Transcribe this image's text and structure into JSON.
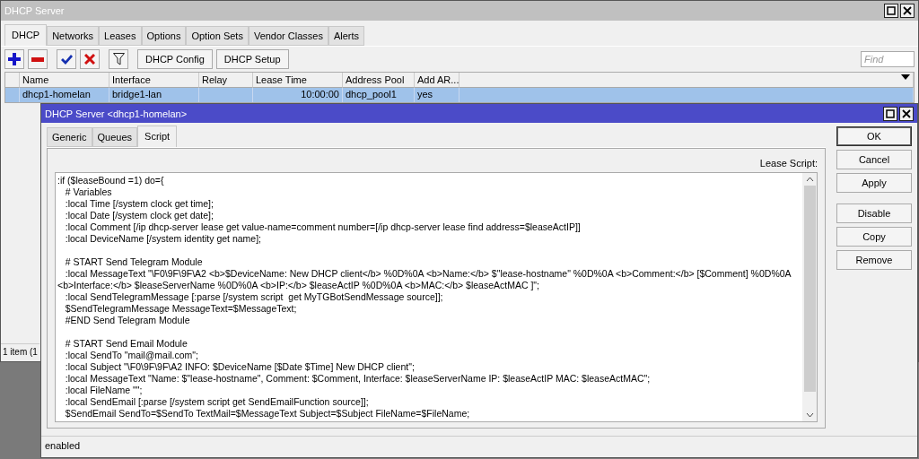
{
  "main_window": {
    "title": "DHCP Server",
    "tabs": [
      {
        "label": "DHCP",
        "selected": true
      },
      {
        "label": "Networks",
        "selected": false
      },
      {
        "label": "Leases",
        "selected": false
      },
      {
        "label": "Options",
        "selected": false
      },
      {
        "label": "Option Sets",
        "selected": false
      },
      {
        "label": "Vendor Classes",
        "selected": false
      },
      {
        "label": "Alerts",
        "selected": false
      }
    ],
    "toolbar": [
      {
        "kind": "add"
      },
      {
        "kind": "remove"
      },
      {
        "kind": "enable"
      },
      {
        "kind": "disable"
      },
      {
        "kind": "filter"
      },
      {
        "kind": "text",
        "label": "DHCP Config"
      },
      {
        "kind": "text",
        "label": "DHCP Setup"
      }
    ],
    "search": {
      "placeholder": "Find"
    },
    "table": {
      "columns": [
        "Name",
        "Interface",
        "Relay",
        "Lease Time",
        "Address Pool",
        "Add AR..."
      ],
      "rows": [
        {
          "selected": true,
          "cells": [
            "dhcp1-homelan",
            "bridge1-lan",
            "",
            "10:00:00",
            "dhcp_pool1",
            "yes"
          ]
        }
      ]
    },
    "status_bar": "1 item (1"
  },
  "dialog": {
    "title": "DHCP Server <dhcp1-homelan>",
    "tabs": [
      {
        "label": "Generic",
        "selected": false
      },
      {
        "label": "Queues",
        "selected": false
      },
      {
        "label": "Script",
        "selected": true
      }
    ],
    "script_label": "Lease Script:",
    "script": ":if ($leaseBound =1) do={\n   # Variables\n   :local Time [/system clock get time];\n   :local Date [/system clock get date];\n   :local Comment [/ip dhcp-server lease get value-name=comment number=[/ip dhcp-server lease find address=$leaseActIP]]\n   :local DeviceName [/system identity get name];\n\n   # START Send Telegram Module\n   :local MessageText \"\\F0\\9F\\9F\\A2 <b>$DeviceName: New DHCP client</b> %0D%0A <b>Name:</b> $\"lease-hostname\" %0D%0A <b>Comment:</b> [$Comment] %0D%0A\n<b>Interface:</b> $leaseServerName %0D%0A <b>IP:</b> $leaseActIP %0D%0A <b>MAC:</b> $leaseActMAC ]\";\n   :local SendTelegramMessage [:parse [/system script  get MyTGBotSendMessage source]];\n   $SendTelegramMessage MessageText=$MessageText;\n   #END Send Telegram Module\n\n   # START Send Email Module\n   :local SendTo \"mail@mail.com\";\n   :local Subject \"\\F0\\9F\\9F\\A2 INFO: $DeviceName [$Date $Time] New DHCP client\";\n   :local MessageText \"Name: $\"lease-hostname\", Comment: $Comment, Interface: $leaseServerName IP: $leaseActIP MAC: $leaseActMAC\";\n   :local FileName \"\";\n   :local SendEmail [:parse [/system script get SendEmailFunction source]];\n   $SendEmail SendTo=$SendTo TextMail=$MessageText Subject=$Subject FileName=$FileName;",
    "button_groups": [
      [
        {
          "label": "OK",
          "default": true
        },
        {
          "label": "Cancel",
          "default": false
        },
        {
          "label": "Apply",
          "default": false
        }
      ],
      [
        {
          "label": "Disable",
          "default": false
        },
        {
          "label": "Copy",
          "default": false
        },
        {
          "label": "Remove",
          "default": false
        }
      ]
    ],
    "status_bar": "enabled"
  }
}
